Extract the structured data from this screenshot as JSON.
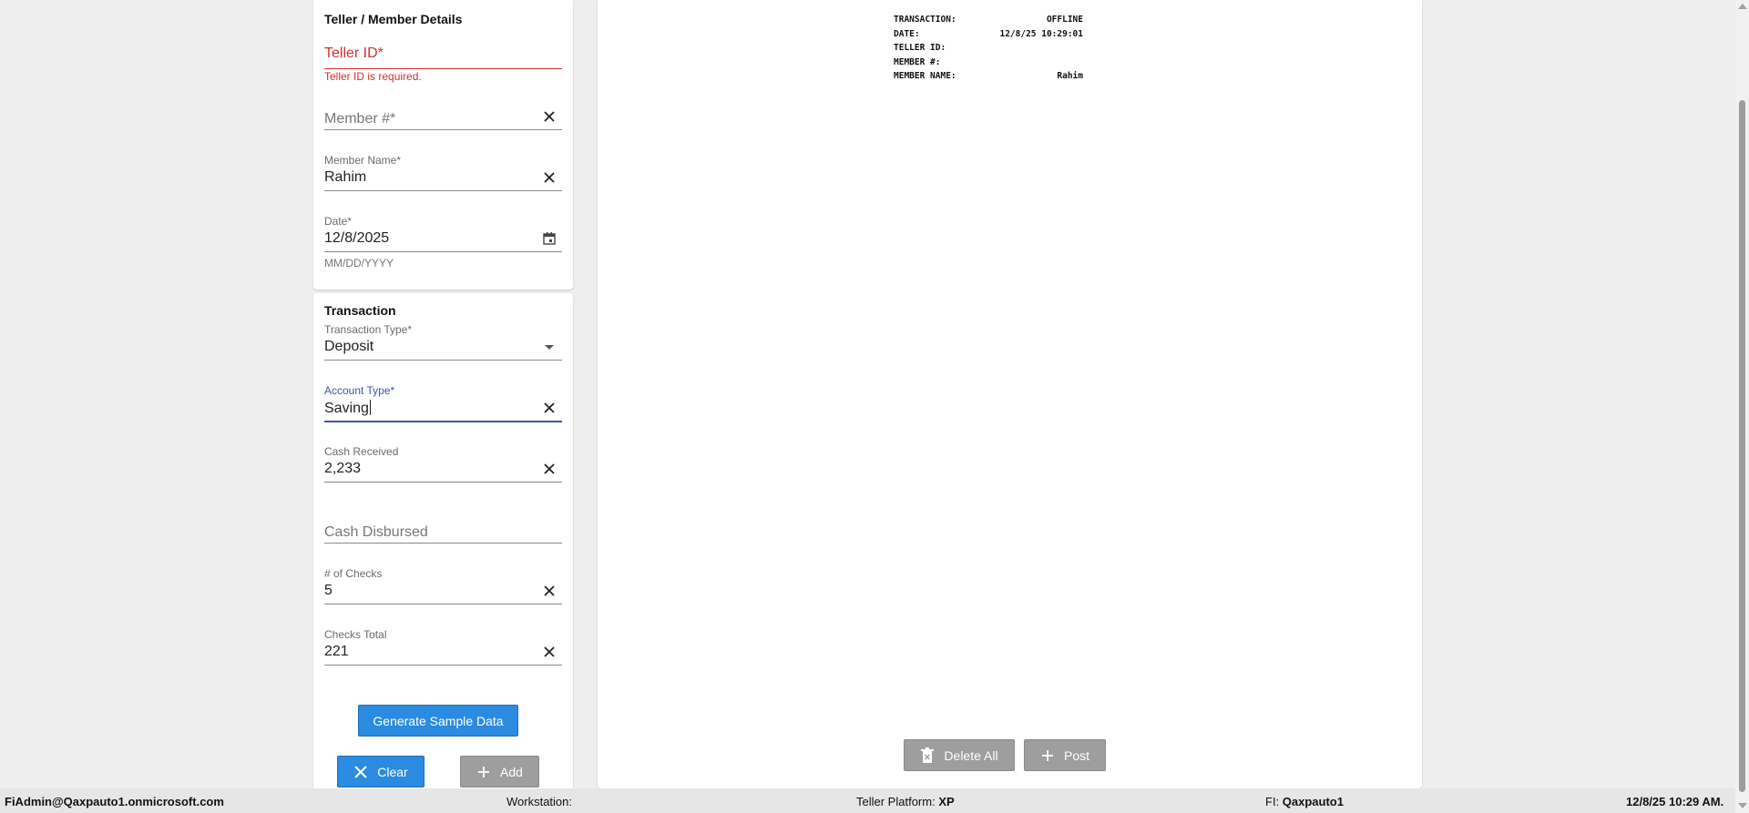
{
  "teller_section": {
    "title": "Teller / Member Details",
    "teller_id": {
      "label": "Teller ID*",
      "error": "Teller ID is required."
    },
    "member_number": {
      "label": "Member #*"
    },
    "member_name": {
      "label": "Member Name*",
      "value": "Rahim"
    },
    "date": {
      "label": "Date*",
      "value": "12/8/2025",
      "hint": "MM/DD/YYYY"
    }
  },
  "transaction_section": {
    "title": "Transaction",
    "transaction_type": {
      "label": "Transaction Type*",
      "value": "Deposit"
    },
    "account_type": {
      "label": "Account Type*",
      "value": "Saving"
    },
    "cash_received": {
      "label": "Cash Received",
      "value": "2,233"
    },
    "cash_disbursed": {
      "label": "Cash Disbursed"
    },
    "num_checks": {
      "label": "# of Checks",
      "value": "5"
    },
    "checks_total": {
      "label": "Checks Total",
      "value": "221"
    }
  },
  "buttons": {
    "generate": "Generate Sample Data",
    "clear": "Clear",
    "add": "Add",
    "delete_all": "Delete All",
    "post": "Post"
  },
  "receipt": {
    "rows": [
      {
        "label": "TRANSACTION:",
        "value": "OFFLINE"
      },
      {
        "label": "DATE:",
        "value": "12/8/25 10:29:01"
      },
      {
        "label": "TELLER ID:",
        "value": ""
      },
      {
        "label": "MEMBER #:",
        "value": ""
      },
      {
        "label": "MEMBER NAME:",
        "value": "Rahim"
      }
    ]
  },
  "status_bar": {
    "user": "FiAdmin@Qaxpauto1.onmicrosoft.com",
    "workstation_label": "Workstation:",
    "platform_label": "Teller Platform:",
    "platform_value": "XP",
    "fi_label": "FI:",
    "fi_value": "Qaxpauto1",
    "datetime": "12/8/25 10:29 AM."
  },
  "colors": {
    "error": "#d32f2f",
    "focus": "#3f51b5",
    "primary_button": "#2b8be0",
    "disabled_button": "#9e9e9e"
  },
  "icons": [
    "close-icon",
    "calendar-icon",
    "dropdown-arrow-icon",
    "plus-icon",
    "trash-icon"
  ]
}
